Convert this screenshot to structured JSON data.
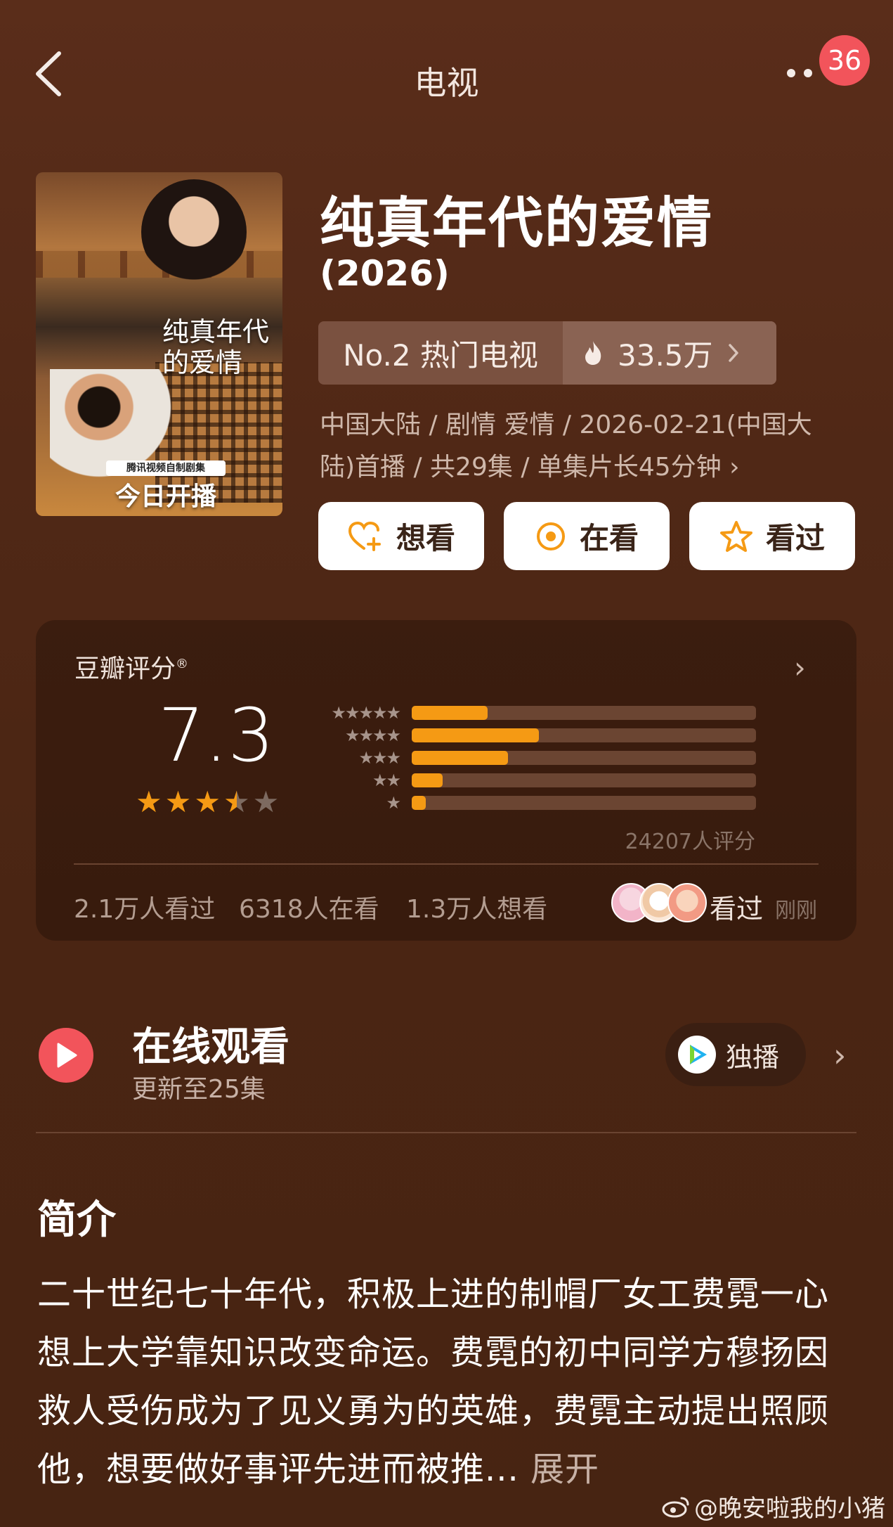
{
  "topbar": {
    "title": "电视",
    "notification_count": "36"
  },
  "poster": {
    "title": "纯真年代的爱情",
    "tag": "腾讯视频自制剧集",
    "banner": "今日开播"
  },
  "show": {
    "title": "纯真年代的爱情",
    "year": "(2026)",
    "rank": "No.2 热门电视",
    "heat": "33.5万",
    "meta_line1": "中国大陆 / 剧情 爱情 / 2026-02-21(中国大",
    "meta_line2": "陆)首播 / 共29集 / 单集片长45分钟"
  },
  "actions": {
    "want": "想看",
    "watching": "在看",
    "watched": "看过"
  },
  "rating": {
    "label": "豆瓣评分",
    "score": "7.3",
    "stars_value": 3.5,
    "distribution": [
      {
        "stars": "★★★★★",
        "fraction": 0.22
      },
      {
        "stars": "★★★★",
        "fraction": 0.37
      },
      {
        "stars": "★★★",
        "fraction": 0.28
      },
      {
        "stars": "★★",
        "fraction": 0.09
      },
      {
        "stars": "★",
        "fraction": 0.04
      }
    ],
    "count": "24207人评分",
    "watched": "2.1万人看过",
    "watching": "6318人在看",
    "want": "1.3万人想看",
    "friend_action": "看过",
    "friend_time": "刚刚"
  },
  "online": {
    "title": "在线观看",
    "subtitle": "更新至25集",
    "exclusive": "独播"
  },
  "synopsis": {
    "title": "简介",
    "text": "二十世纪七十年代，积极上进的制帽厂女工费霓一心想上大学靠知识改变命运。费霓的初中同学方穆扬因救人受伤成为了见义勇为的英雄，费霓主动提出照顾他，想要做好事评先进而被推...",
    "more": "展开"
  },
  "watermark": "@晚安啦我的小猪",
  "colors": {
    "accent": "#f59a14",
    "badge": "#f2545b",
    "background": "#502816"
  }
}
